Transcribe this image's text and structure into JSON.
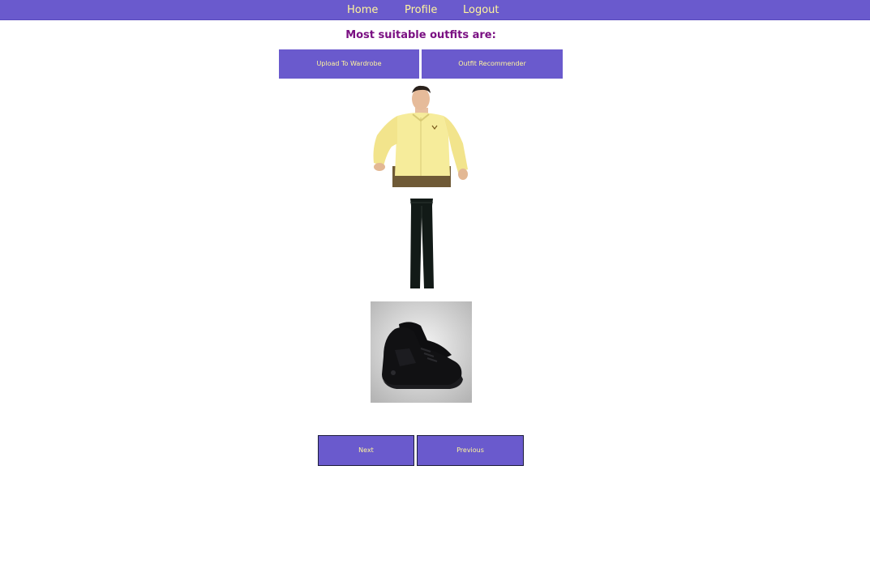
{
  "nav": {
    "home": "Home",
    "profile": "Profile",
    "logout": "Logout"
  },
  "page": {
    "title": "Most suitable outfits are:"
  },
  "actions": {
    "upload": "Upload To Wardrobe",
    "recommend": "Outfit Recommender"
  },
  "outfit": {
    "items": [
      {
        "kind": "shirt",
        "color": "#f7ec9a"
      },
      {
        "kind": "pants",
        "color": "#111a16"
      },
      {
        "kind": "shoes",
        "color": "#0e0e10"
      }
    ]
  },
  "pagination": {
    "next": "Next",
    "previous": "Previous"
  },
  "colors": {
    "accent": "#6a5acd",
    "accent_text": "#fff59d",
    "title": "#7a1082"
  }
}
